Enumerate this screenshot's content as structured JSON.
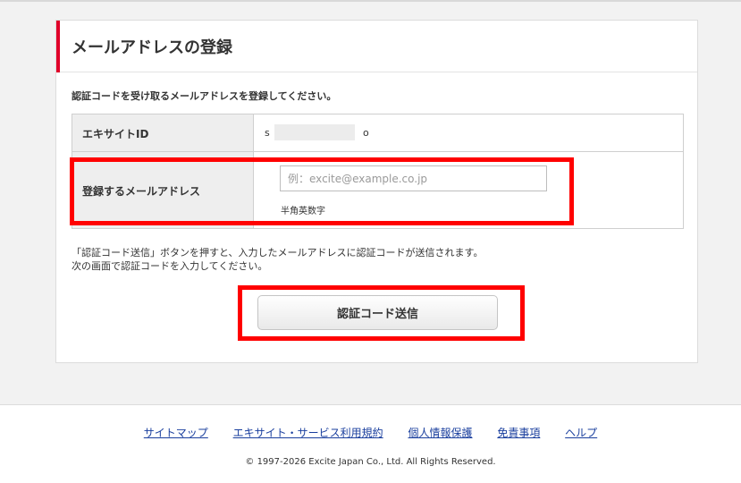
{
  "page": {
    "title": "メールアドレスの登録",
    "intro": "認証コードを受け取るメールアドレスを登録してください。"
  },
  "form": {
    "user_id_label": "エキサイトID",
    "user_id_start": "s",
    "user_id_end": "o",
    "email_label": "登録するメールアドレス",
    "email_placeholder": "例：excite@example.co.jp",
    "email_value": "",
    "email_hint": "半角英数字"
  },
  "notice": {
    "line1": "「認証コード送信」ボタンを押すと、入力したメールアドレスに認証コードが送信されます。",
    "line2": "次の画面で認証コードを入力してください。"
  },
  "submit_label": "認証コード送信",
  "footer": {
    "links": [
      "サイトマップ",
      "エキサイト・サービス利用規約",
      "個人情報保護",
      "免責事項",
      "ヘルプ"
    ],
    "copyright": "© 1997-2026 Excite Japan Co., Ltd. All Rights Reserved."
  },
  "colors": {
    "accent": "#e0002a",
    "highlight": "#ff0000",
    "link": "#1a3f9e"
  }
}
